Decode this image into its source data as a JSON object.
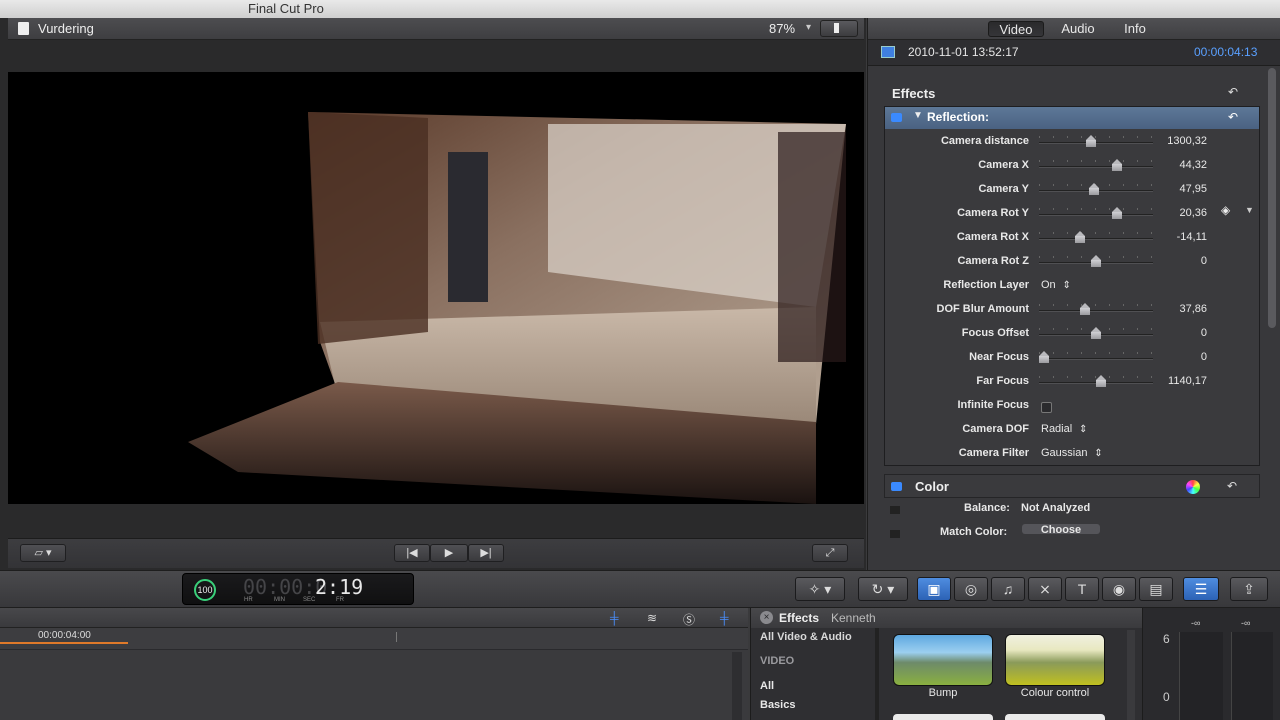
{
  "app_title": "Final Cut Pro",
  "viewer": {
    "clip_name": "Vurdering",
    "zoom": "87%"
  },
  "inspector": {
    "tabs": [
      "Video",
      "Audio",
      "Info"
    ],
    "active_tab": "Video",
    "clip_date": "2010-11-01 13:52:17",
    "clip_duration": "00:00:04:13",
    "effects_header": "Effects",
    "effect_name": "Reflection:",
    "params": [
      {
        "label": "Camera distance",
        "value": "1300,32",
        "slider": 0.45
      },
      {
        "label": "Camera X",
        "value": "44,32",
        "slider": 0.7
      },
      {
        "label": "Camera Y",
        "value": "47,95",
        "slider": 0.48
      },
      {
        "label": "Camera Rot Y",
        "value": "20,36",
        "slider": 0.7
      },
      {
        "label": "Camera Rot X",
        "value": "-14,11",
        "slider": 0.35
      },
      {
        "label": "Camera Rot Z",
        "value": "0",
        "slider": 0.5
      },
      {
        "label": "Reflection Layer",
        "popup": "On"
      },
      {
        "label": "DOF Blur Amount",
        "value": "37,86",
        "slider": 0.39
      },
      {
        "label": "Focus Offset",
        "value": "0",
        "slider": 0.5
      },
      {
        "label": "Near Focus",
        "value": "0",
        "slider": 0.0
      },
      {
        "label": "Far Focus",
        "value": "1140,17",
        "slider": 0.55
      },
      {
        "label": "Infinite Focus",
        "checkbox": true
      },
      {
        "label": "Camera DOF",
        "popup": "Radial"
      },
      {
        "label": "Camera Filter",
        "popup": "Gaussian"
      }
    ],
    "color_section": "Color",
    "balance_label": "Balance:",
    "balance_value": "Not Analyzed",
    "match_color_label": "Match Color:",
    "match_color_button": "Choose"
  },
  "timecode": {
    "percent": "100",
    "value": "00:00:02:19",
    "dim_part": "00:00:0",
    "bright_part": "2:19",
    "units": [
      "HR",
      "MIN",
      "SEC",
      "FR"
    ]
  },
  "timeline": {
    "ruler_time": "00:00:04:00"
  },
  "browser": {
    "title": "Effects",
    "user": "Kenneth",
    "categories": [
      "All Video & Audio",
      "VIDEO",
      "All",
      "Basics"
    ],
    "thumbnails": [
      "Bump",
      "Colour control"
    ]
  },
  "meters": {
    "labels": [
      "-∞",
      "-∞"
    ],
    "scale": [
      "6",
      "0"
    ]
  }
}
